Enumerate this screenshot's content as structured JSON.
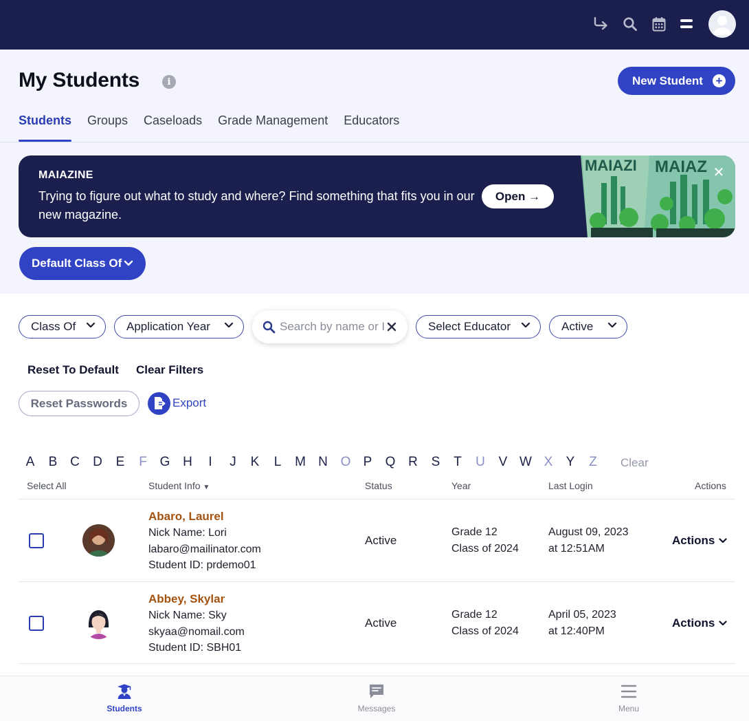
{
  "topbar": {
    "icons": [
      "logout-arrow-icon",
      "search-icon",
      "calendar-icon",
      "toggle-menu-icon",
      "user-avatar"
    ]
  },
  "header": {
    "title": "My Students",
    "info_icon": "i",
    "new_student_label": "New Student"
  },
  "tabs": [
    {
      "label": "Students",
      "active": true
    },
    {
      "label": "Groups",
      "active": false
    },
    {
      "label": "Caseloads",
      "active": false
    },
    {
      "label": "Grade Management",
      "active": false
    },
    {
      "label": "Educators",
      "active": false
    }
  ],
  "banner": {
    "title": "MAIAZINE",
    "text": "Trying to figure out what to study and where? Find something that fits you in our new magazine.",
    "open_label": "Open →",
    "close_label": "✕"
  },
  "class_of_dropdown": {
    "label": "Default Class Of"
  },
  "filters": {
    "class_of": "Class Of",
    "application_year": "Application Year",
    "search_placeholder": "Search by name or ID",
    "select_educator": "Select Educator",
    "status": "Active"
  },
  "actions": {
    "reset_default": "Reset To Default",
    "clear_filters": "Clear Filters",
    "reset_passwords": "Reset Passwords",
    "export": "Export"
  },
  "alphabet": {
    "letters": [
      "A",
      "B",
      "C",
      "D",
      "E",
      "F",
      "G",
      "H",
      "I",
      "J",
      "K",
      "L",
      "M",
      "N",
      "O",
      "P",
      "Q",
      "R",
      "S",
      "T",
      "U",
      "V",
      "W",
      "X",
      "Y",
      "Z"
    ],
    "dimmed": [
      "F",
      "O",
      "U",
      "X",
      "Z"
    ],
    "clear_label": "Clear"
  },
  "table": {
    "headers": {
      "select_all": "Select All",
      "student_info": "Student Info",
      "status": "Status",
      "year": "Year",
      "last_login": "Last Login",
      "actions": "Actions"
    },
    "rows": [
      {
        "name": "Abaro, Laurel",
        "nick": "Nick Name: Lori",
        "email": "labaro@mailinator.com",
        "student_id": "Student ID: prdemo01",
        "status": "Active",
        "grade": "Grade 12",
        "class_of": "Class of 2024",
        "login_date": "August 09, 2023",
        "login_time": "at 12:51AM",
        "actions_label": "Actions"
      },
      {
        "name": "Abbey, Skylar",
        "nick": "Nick Name: Sky",
        "email": "skyaa@nomail.com",
        "student_id": "Student ID: SBH01",
        "status": "Active",
        "grade": "Grade 12",
        "class_of": "Class of 2024",
        "login_date": "April 05, 2023",
        "login_time": "at 12:40PM",
        "actions_label": "Actions"
      }
    ]
  },
  "bottom_nav": [
    {
      "label": "Students",
      "icon": "graduate-icon",
      "active": true
    },
    {
      "label": "Messages",
      "icon": "message-icon",
      "active": false
    },
    {
      "label": "Menu",
      "icon": "hamburger-icon",
      "active": false
    }
  ],
  "colors": {
    "navy": "#1b1f4d",
    "primary": "#3043c4",
    "name_link": "#a4520f",
    "header_bg": "#f3f4fc"
  }
}
